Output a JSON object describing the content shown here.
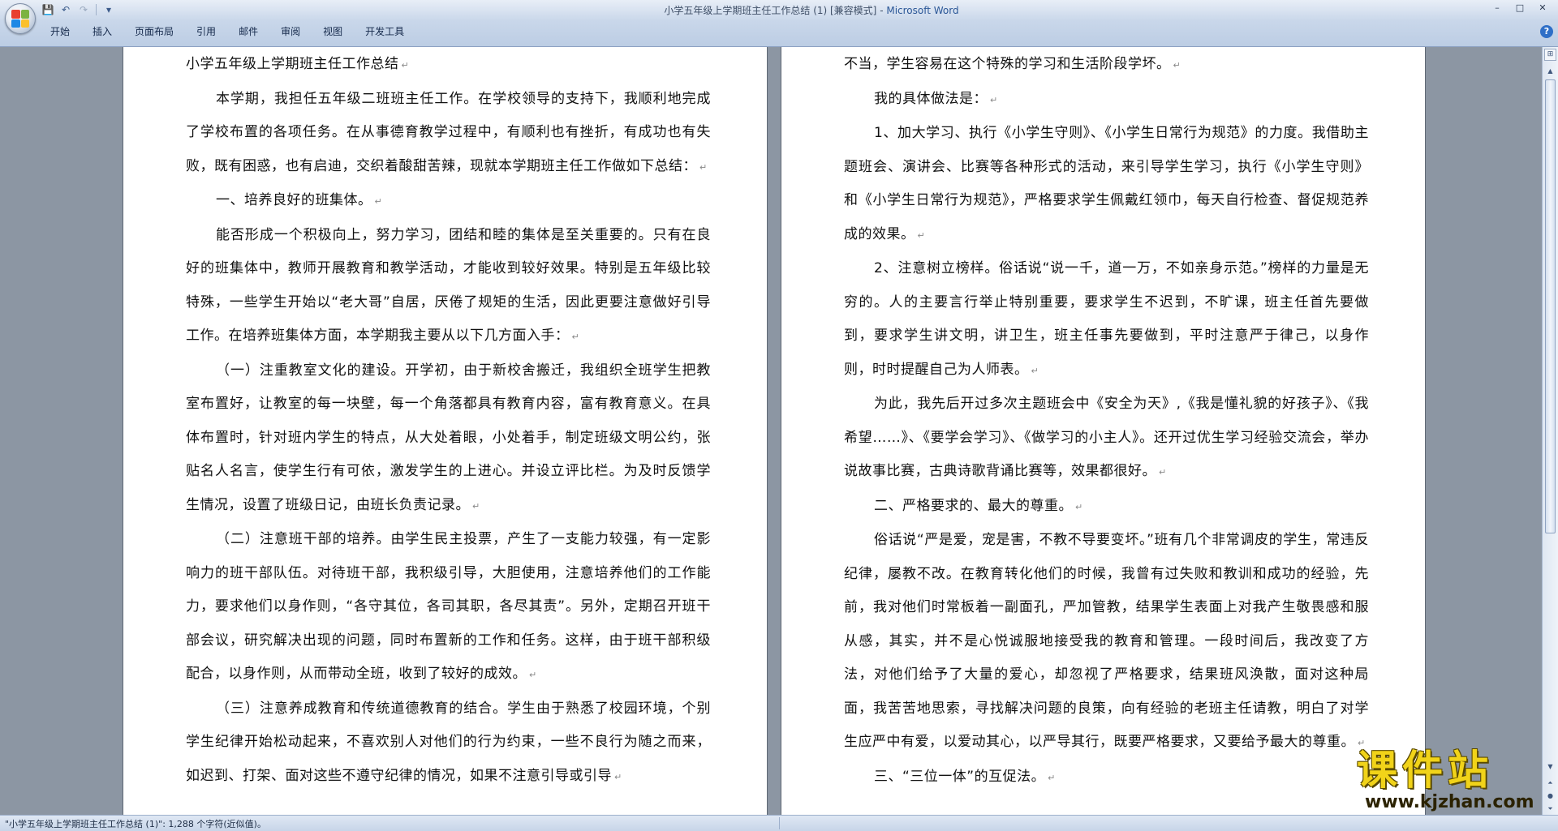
{
  "window": {
    "title_doc": "小学五年级上学期班主任工作总结 (1) [兼容模式]",
    "title_sep": " - ",
    "title_app": "Microsoft Word",
    "controls": [
      "–",
      "□",
      "✕"
    ]
  },
  "quick_access": {
    "save_glyph": "💾",
    "undo_glyph": "↶",
    "redo_glyph": "↷",
    "customize_glyph": "▾"
  },
  "ribbon": {
    "tabs": [
      "开始",
      "插入",
      "页面布局",
      "引用",
      "邮件",
      "审阅",
      "视图",
      "开发工具"
    ],
    "help_glyph": "?"
  },
  "document": {
    "left_page": [
      {
        "text": "小学五年级上学期班主任工作总结",
        "indent": false
      },
      {
        "text": "本学期，我担任五年级二班班主任工作。在学校领导的支持下，我顺利地完成了学校布置的各项任务。在从事德育教学过程中，有顺利也有挫折，有成功也有失败，既有困惑，也有启迪，交织着酸甜苦辣，现就本学期班主任工作做如下总结：",
        "indent": true
      },
      {
        "text": "一、培养良好的班集体。",
        "indent": true
      },
      {
        "text": "能否形成一个积极向上，努力学习，团结和睦的集体是至关重要的。只有在良好的班集体中，教师开展教育和教学活动，才能收到较好效果。特别是五年级比较特殊，一些学生开始以“老大哥”自居，厌倦了规矩的生活，因此更要注意做好引导工作。在培养班集体方面，本学期我主要从以下几方面入手：",
        "indent": true
      },
      {
        "text": "（一）注重教室文化的建设。开学初，由于新校舍搬迁，我组织全班学生把教室布置好，让教室的每一块壁，每一个角落都具有教育内容，富有教育意义。在具体布置时，针对班内学生的特点，从大处着眼，小处着手，制定班级文明公约，张贴名人名言，使学生行有可依，激发学生的上进心。并设立评比栏。为及时反馈学生情况，设置了班级日记，由班长负责记录。",
        "indent": true
      },
      {
        "text": "（二）注意班干部的培养。由学生民主投票，产生了一支能力较强，有一定影响力的班干部队伍。对待班干部，我积级引导，大胆使用，注意培养他们的工作能力，要求他们以身作则，“各守其位，各司其职，各尽其责”。另外，定期召开班干部会议，研究解决出现的问题，同时布置新的工作和任务。这样，由于班干部积级配合，以身作则，从而带动全班，收到了较好的成效。",
        "indent": true
      },
      {
        "text": "（三）注意养成教育和传统道德教育的结合。学生由于熟悉了校园环境，个别学生纪律开始松动起来，不喜欢别人对他们的行为约束，一些不良行为随之而来，如迟到、打架、面对这些不遵守纪律的情况，如果不注意引导或引导",
        "indent": true
      }
    ],
    "right_page": [
      {
        "text": "不当，学生容易在这个特殊的学习和生活阶段学坏。",
        "indent": false
      },
      {
        "text": "我的具体做法是：",
        "indent": true
      },
      {
        "text": "1、加大学习、执行《小学生守则》、《小学生日常行为规范》的力度。我借助主题班会、演讲会、比赛等各种形式的活动，来引导学生学习，执行《小学生守则》和《小学生日常行为规范》，严格要求学生佩戴红领巾，每天自行检查、督促规范养成的效果。",
        "indent": true
      },
      {
        "text": "2、注意树立榜样。俗话说“说一千，道一万，不如亲身示范。”榜样的力量是无穷的。人的主要言行举止特别重要，要求学生不迟到，不旷课，班主任首先要做到，要求学生讲文明，讲卫生，班主任事先要做到，平时注意严于律己，以身作则，时时提醒自己为人师表。",
        "indent": true
      },
      {
        "text": "为此，我先后开过多次主题班会中《安全为天》,《我是懂礼貌的好孩子》、《我希望……》、《要学会学习》、《做学习的小主人》。还开过优生学习经验交流会，举办说故事比赛，古典诗歌背诵比赛等，效果都很好。",
        "indent": true
      },
      {
        "text": "二、严格要求的、最大的尊重。",
        "indent": true
      },
      {
        "text": "俗话说“严是爱，宠是害，不教不导要变坏。”班有几个非常调皮的学生，常违反纪律，屡教不改。在教育转化他们的时候，我曾有过失败和教训和成功的经验，先前，我对他们时常板着一副面孔，严加管教，结果学生表面上对我产生敬畏感和服从感，其实，并不是心悦诚服地接受我的教育和管理。一段时间后，我改变了方法，对他们给予了大量的爱心，却忽视了严格要求，结果班风涣散，面对这种局面，我苦苦地思索，寻找解决问题的良策，向有经验的老班主任请教，明白了对学生应严中有爱，以爱动其心，以严导其行，既要严格要求，又要给予最大的尊重。",
        "indent": true
      },
      {
        "text": "三、“三位一体”的互促法。",
        "indent": true
      }
    ]
  },
  "statusbar": {
    "text": "\"小学五年级上学期班主任工作总结 (1)\": 1,288 个字符(近似值)。"
  },
  "watermark": {
    "cn": "课件站",
    "url": "www.kjzhan.com"
  },
  "colors": {
    "office_logo": [
      "#e8412f",
      "#7cb342",
      "#1e88e5",
      "#fbc02d"
    ],
    "watermark_yellow": "#f1d319",
    "app_title_blue": "#2b5797"
  }
}
